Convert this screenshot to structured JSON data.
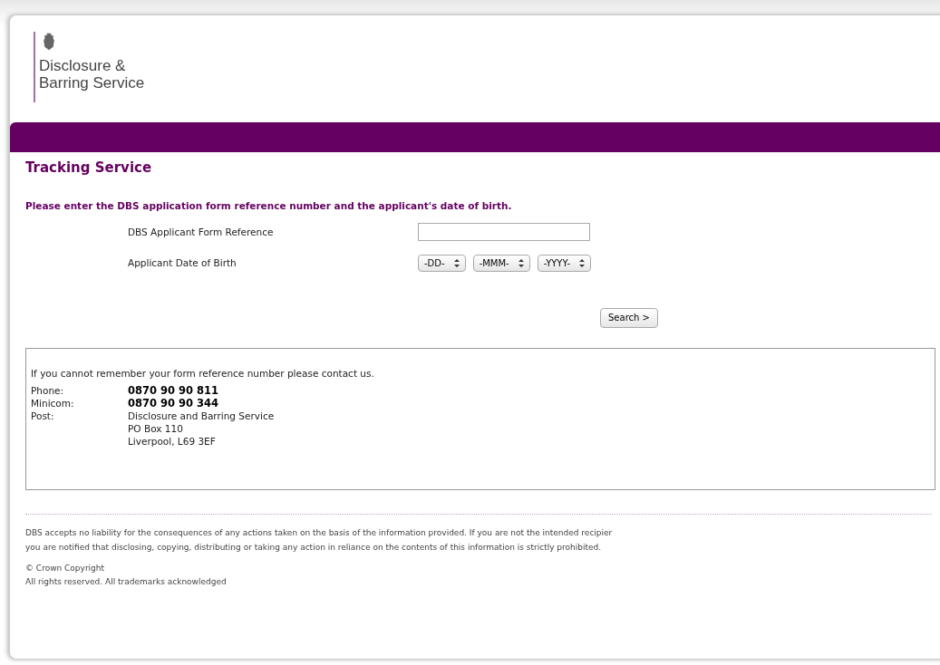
{
  "logo": {
    "line1": "Disclosure &",
    "line2": "Barring Service"
  },
  "heading": "Tracking Service",
  "instruction": "Please enter the DBS application form reference number and the applicant's date of birth.",
  "form": {
    "reference_label": "DBS Applicant Form Reference",
    "dob_label": "Applicant Date of Birth",
    "dob_selects": [
      {
        "value": "-DD-"
      },
      {
        "value": "-MMM-"
      },
      {
        "value": "-YYYY-"
      }
    ],
    "search_button": "Search >"
  },
  "contact": {
    "intro": "If you cannot remember your form reference number please contact us.",
    "rows": [
      {
        "label": "Phone:",
        "lines": [
          "0870 90 90 811"
        ],
        "bold": true
      },
      {
        "label": "Minicom:",
        "lines": [
          "0870 90 90 344"
        ],
        "bold": true
      },
      {
        "label": "Post:",
        "lines": [
          "Disclosure and Barring Service",
          "PO Box 110",
          "Liverpool, L69 3EF"
        ],
        "bold": false
      }
    ]
  },
  "footer": {
    "disclaimer": [
      "DBS accepts no liability for the consequences of any actions taken on the basis of the information provided. If you are not the intended recipier",
      "you are notified that disclosing, copying, distributing or taking any action in reliance on the contents of this information is strictly prohibited."
    ],
    "copyright": "© Crown Copyright",
    "rights": "All rights reserved. All trademarks acknowledged"
  }
}
